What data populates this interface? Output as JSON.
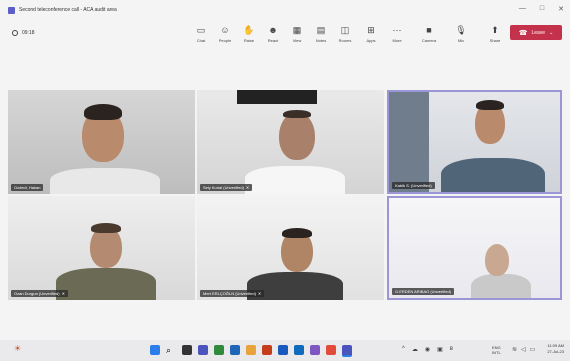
{
  "window": {
    "title": "Second teleconference call - ACA audit area",
    "controls": [
      "—",
      "□",
      "✕"
    ]
  },
  "meeting": {
    "timer": "09:18"
  },
  "toolbar": {
    "items": [
      {
        "label": "Chat",
        "icon": "chat-icon",
        "glyph": "▭"
      },
      {
        "label": "People",
        "icon": "people-icon",
        "glyph": "☺"
      },
      {
        "label": "Raise",
        "icon": "raise-hand-icon",
        "glyph": "✋"
      },
      {
        "label": "React",
        "icon": "react-icon",
        "glyph": "☻"
      },
      {
        "label": "View",
        "icon": "view-icon",
        "glyph": "▦"
      },
      {
        "label": "Notes",
        "icon": "notes-icon",
        "glyph": "▤"
      },
      {
        "label": "Rooms",
        "icon": "rooms-icon",
        "glyph": "◫"
      },
      {
        "label": "Apps",
        "icon": "apps-icon",
        "glyph": "⊞"
      },
      {
        "label": "More",
        "icon": "more-icon",
        "glyph": "⋯"
      },
      {
        "label": "Camera",
        "icon": "camera-icon",
        "glyph": "■"
      },
      {
        "label": "Mic",
        "icon": "mic-icon",
        "glyph": "🎙"
      },
      {
        "label": "Share",
        "icon": "share-icon",
        "glyph": "⬆"
      }
    ],
    "leave_label": "Leave"
  },
  "participants": [
    {
      "name": "Ozdedi, Hakan"
    },
    {
      "name": "Sely Kurial (Unverified)"
    },
    {
      "name": "Kabik S. (Unverified)"
    },
    {
      "name": "Ozan Durgun (Unverified)"
    },
    {
      "name": "Mert ERLÇOĞLN (Unverified)"
    },
    {
      "name": "G.ERDEN ARIBAO (Unverified)"
    }
  ],
  "taskbar": {
    "lang": "ENG",
    "lang_sub": "INTL",
    "time": "11:09 AM",
    "date": "27-Jul-23"
  },
  "colors": {
    "accent": "#5b5fc7",
    "leave": "#c4314b",
    "active_border": "#9b96d6"
  }
}
